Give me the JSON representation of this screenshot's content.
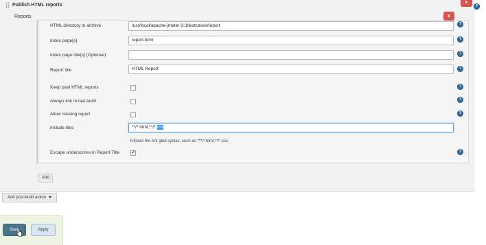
{
  "section": {
    "title": "Publish HTML reports",
    "close_label": "x",
    "help_label": "?",
    "sidebar_label": "Reports"
  },
  "report": {
    "delete_label": "x",
    "fields": [
      {
        "label": "HTML directory to archive",
        "value": "/usr/local/apache-jmeter-3.3/testcases/report"
      },
      {
        "label": "Index page[s]",
        "value": "report.html"
      },
      {
        "label": "Index page title[s] (Optional)",
        "value": ""
      },
      {
        "label": "Report title",
        "value": "HTML Report"
      }
    ],
    "checkboxes": [
      {
        "label": "Keep past HTML reports",
        "checked": false
      },
      {
        "label": "Always link to last build",
        "checked": false
      },
      {
        "label": "Allow missing report",
        "checked": false
      }
    ],
    "include_files": {
      "label": "Include files",
      "value_prefix": "**/*.html,**/*.",
      "value_selected": "css",
      "hint": "Follows the Ant glob syntax, such as \"**/*.html,**/*.css"
    },
    "escape": {
      "label": "Escape underscores in Report Title",
      "checked": true,
      "mark": "✔"
    }
  },
  "buttons": {
    "add": "Add",
    "add_post_build": "Add post-build action",
    "save": "Save",
    "apply": "Apply"
  },
  "colors": {
    "close": "#d9534f",
    "help": "#2f70a8",
    "save": "#4b758b",
    "apply": "#dbe6f3",
    "footer": "#eef3e4"
  }
}
